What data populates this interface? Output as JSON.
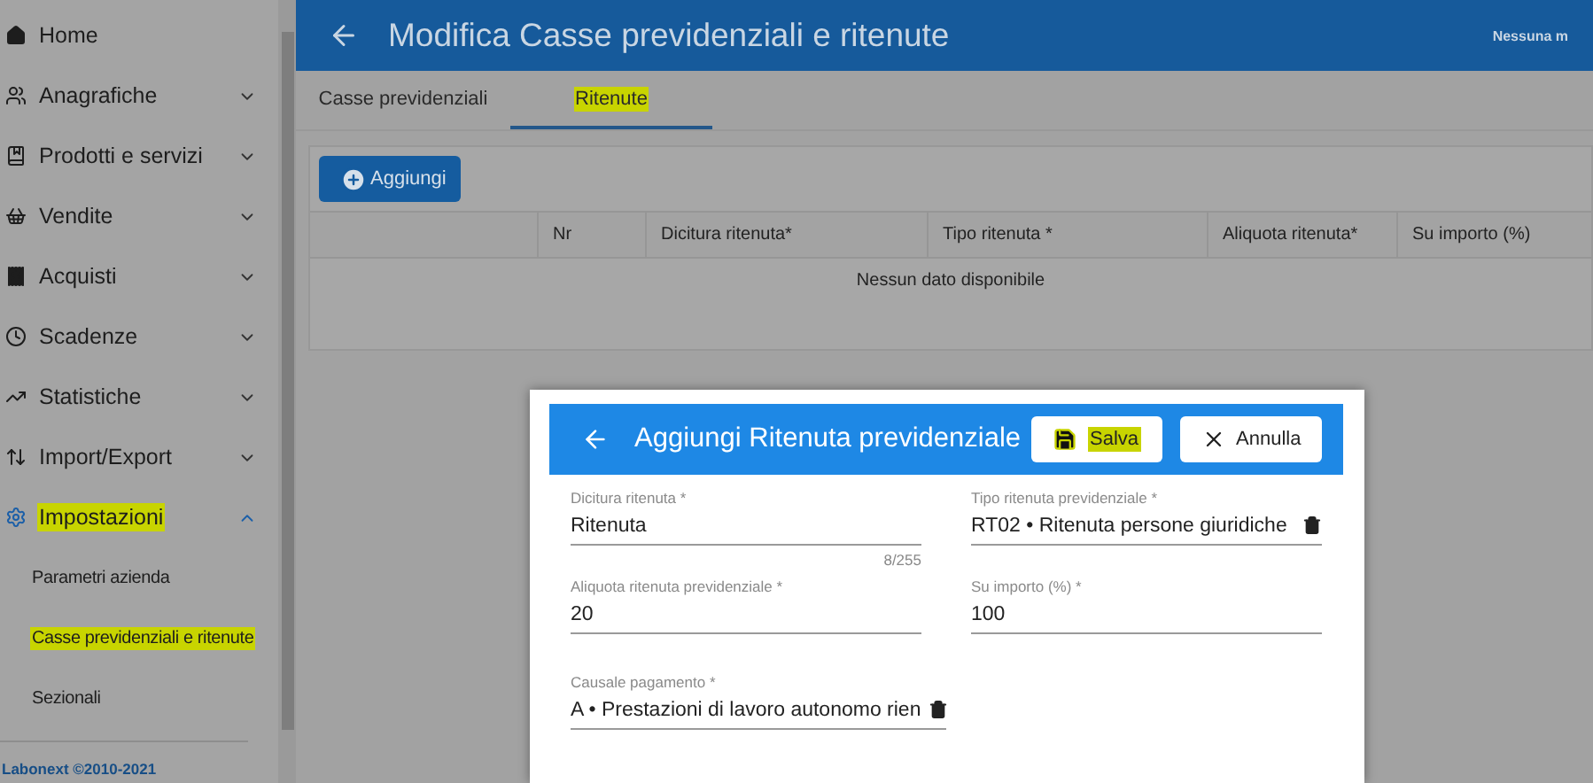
{
  "sidebar": {
    "items": [
      {
        "label": "Home",
        "highlighted": false
      },
      {
        "label": "Anagrafiche",
        "expanded": false,
        "highlighted": false
      },
      {
        "label": "Prodotti e servizi",
        "expanded": false,
        "highlighted": false
      },
      {
        "label": "Vendite",
        "expanded": false,
        "highlighted": false
      },
      {
        "label": "Acquisti",
        "expanded": false,
        "highlighted": false
      },
      {
        "label": "Scadenze",
        "expanded": false,
        "highlighted": false
      },
      {
        "label": "Statistiche",
        "expanded": false,
        "highlighted": false
      },
      {
        "label": "Import/Export",
        "expanded": false,
        "highlighted": false
      },
      {
        "label": "Impostazioni",
        "expanded": true,
        "highlighted": true,
        "children": [
          {
            "label": "Parametri azienda",
            "highlighted": false
          },
          {
            "label": "Casse previdenziali e ritenute",
            "highlighted": true
          },
          {
            "label": "Sezionali",
            "highlighted": false
          }
        ]
      }
    ],
    "footer": "Labonext ©2010-2021"
  },
  "header": {
    "title": "Modifica Casse previdenziali e ritenute",
    "status": "Nessuna m"
  },
  "tabs": [
    {
      "label": "Casse previdenziali",
      "selected": false,
      "highlighted": false
    },
    {
      "label": "Ritenute",
      "selected": true,
      "highlighted": true
    }
  ],
  "add_button": "Aggiungi",
  "table": {
    "columns": [
      "",
      "Nr",
      "Dicitura ritenuta*",
      "Tipo ritenuta *",
      "Aliquota ritenuta*",
      "Su importo (%)"
    ],
    "empty": "Nessun dato disponibile"
  },
  "dialog": {
    "title": "Aggiungi Ritenuta previdenziale",
    "save": {
      "label": "Salva",
      "highlighted": true
    },
    "cancel": "Annulla",
    "fields": [
      {
        "kind": "text",
        "label": "Dicitura ritenuta *",
        "value": "Ritenuta",
        "counter": "8/255"
      },
      {
        "kind": "select",
        "label": "Tipo ritenuta previdenziale *",
        "value": "RT02 • Ritenuta persone giuridiche"
      },
      {
        "kind": "text",
        "label": "Aliquota ritenuta previdenziale *",
        "value": "20"
      },
      {
        "kind": "text",
        "label": "Su importo (%) *",
        "value": "100"
      },
      {
        "kind": "select",
        "label": "Causale pagamento *",
        "value": "A • Prestazioni di lavoro autonomo rien"
      }
    ]
  }
}
